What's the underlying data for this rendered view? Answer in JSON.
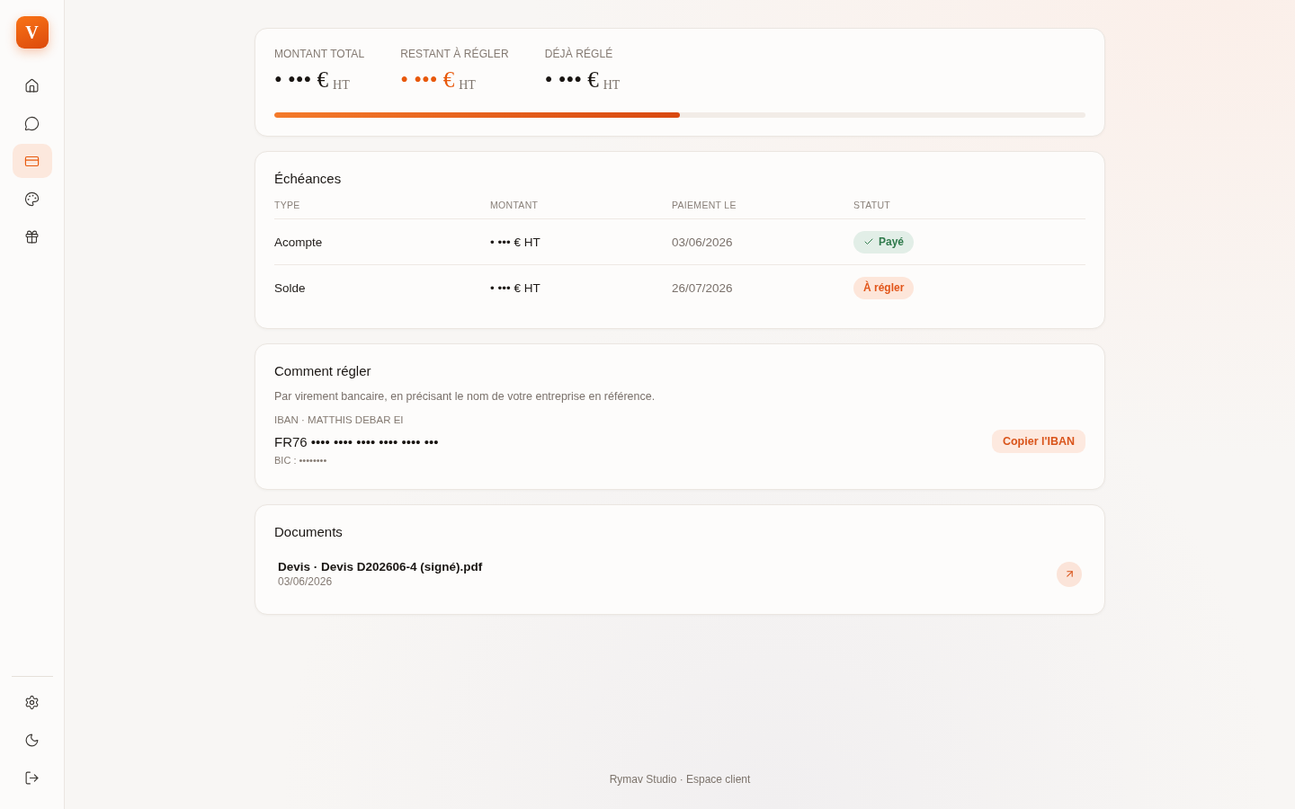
{
  "sidebar": {
    "logo": "V",
    "nav": [
      {
        "selected": false
      },
      {
        "selected": false
      },
      {
        "selected": true
      },
      {
        "selected": false
      },
      {
        "selected": false
      }
    ]
  },
  "summary": {
    "stats": [
      {
        "label": "MONTANT TOTAL",
        "value": "• ••• €",
        "unit": "HT",
        "highlighted": false
      },
      {
        "label": "RESTANT À RÉGLER",
        "value": "• ••• €",
        "unit": "HT",
        "highlighted": true
      },
      {
        "label": "DÉJÀ RÉGLÉ",
        "value": "• ••• €",
        "unit": "HT",
        "highlighted": false
      }
    ],
    "progress": {
      "level": 0.5
    }
  },
  "schedule": {
    "title": "Échéances",
    "columns": [
      "TYPE",
      "MONTANT",
      "PAIEMENT LE",
      "STATUT"
    ],
    "rows": [
      {
        "type": "Acompte",
        "amount": "• ••• € HT",
        "date": "03/06/2026",
        "status": {
          "kind": "paid",
          "label": "Payé"
        }
      },
      {
        "type": "Solde",
        "amount": "• ••• € HT",
        "date": "26/07/2026",
        "status": {
          "kind": "due",
          "label": "À régler"
        }
      }
    ]
  },
  "payment": {
    "title": "Comment régler",
    "description": "Par virement bancaire, en précisant le nom de votre entreprise en référence.",
    "iban_label": "IBAN · MATTHIS DEBAR EI",
    "iban": "FR76 •••• •••• •••• •••• •••• •••",
    "bic": "BIC : ••••••••",
    "copy_button": "Copier l'IBAN"
  },
  "documents": {
    "title": "Documents",
    "items": [
      {
        "name": "Devis · Devis D202606-4 (signé).pdf",
        "date": "03/06/2026"
      }
    ]
  },
  "footer": "Rymav Studio · Espace client"
}
